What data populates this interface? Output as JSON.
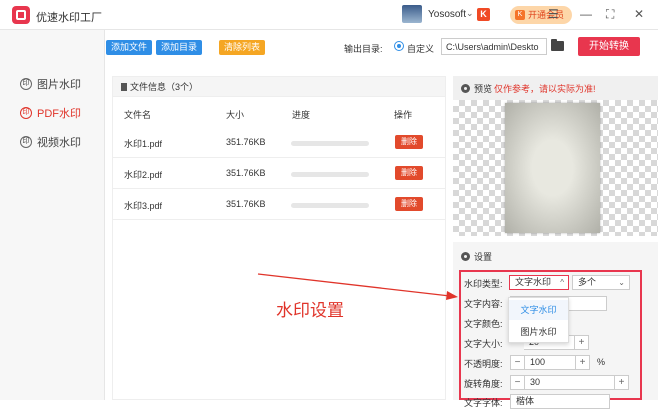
{
  "app": {
    "title": "优速水印工厂",
    "username": "Yososoft",
    "user_chevron": "⌄",
    "vip_badge": "K",
    "vip_button": "开通会员",
    "window_controls": [
      "☰",
      "—",
      "⛶",
      "✕"
    ]
  },
  "sidebar": {
    "items": [
      {
        "label": "图片水印",
        "active": false
      },
      {
        "label": "PDF水印",
        "active": true
      },
      {
        "label": "视频水印",
        "active": false
      }
    ]
  },
  "toolbar": {
    "add_file": "添加文件",
    "add_dir": "添加目录",
    "clear_list": "清除列表",
    "output_label": "输出目录:",
    "radio_label": "自定义",
    "output_path": "C:\\Users\\admin\\Deskto",
    "start": "开始转换"
  },
  "files": {
    "header": "文件信息（3个）",
    "columns": [
      "文件名",
      "大小",
      "进度",
      "操作"
    ],
    "rows": [
      {
        "name": "水印1.pdf",
        "size": "351.76KB",
        "action": "删除",
        "progress": 0
      },
      {
        "name": "水印2.pdf",
        "size": "351.76KB",
        "action": "删除",
        "progress": 0
      },
      {
        "name": "水印3.pdf",
        "size": "351.76KB",
        "action": "删除",
        "progress": 0
      }
    ]
  },
  "preview": {
    "title": "预览",
    "note": "仅作参考，请以实际为准!"
  },
  "settings": {
    "title": "设置",
    "type_label": "水印类型:",
    "type_value": "文字水印",
    "type_arrow": "^",
    "mode_value": "多个",
    "mode_arrow": "⌄",
    "dropdown": [
      "文字水印",
      "图片水印"
    ],
    "content_label": "文字内容:",
    "color_label": "文字颜色:",
    "size_label": "文字大小:",
    "size_value": "20",
    "opacity_label": "不透明度:",
    "opacity_value": "100",
    "opacity_unit": "%",
    "rotation_label": "旋转角度:",
    "rotation_value": "30",
    "font_label": "文字字体:",
    "font_value": "楷体",
    "minus": "−",
    "plus": "+"
  },
  "annotation": {
    "text": "水印设置"
  },
  "colors": {
    "accent_red": "#e8364e",
    "blue": "#2f8ee6",
    "orange": "#f5a623",
    "delete_red": "#e24a2c"
  }
}
